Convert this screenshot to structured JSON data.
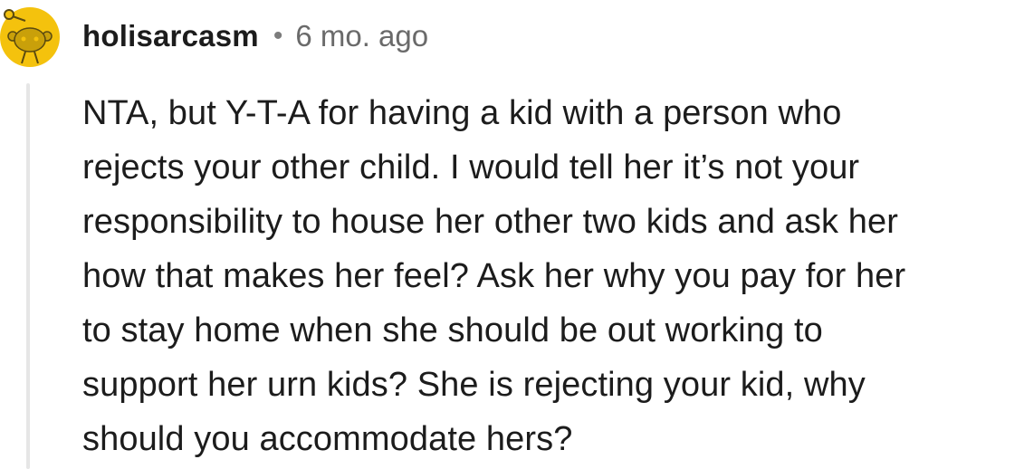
{
  "comment": {
    "author": "holisarcasm",
    "separator": "•",
    "timestamp": "6 mo. ago",
    "avatar_icon": "snoo-avatar-icon",
    "avatar_color": "#f4c20d",
    "body_lines": [
      "NTA, but Y-T-A for having a kid with a person who",
      "rejects your other child. I would tell her it’s not your",
      "responsibility to house her other two kids and ask her",
      "how that makes her feel? Ask her why you pay for her",
      "to stay home when she should be out working to",
      "support her urn kids? She is rejecting your kid, why",
      "should you accommodate hers?"
    ]
  }
}
